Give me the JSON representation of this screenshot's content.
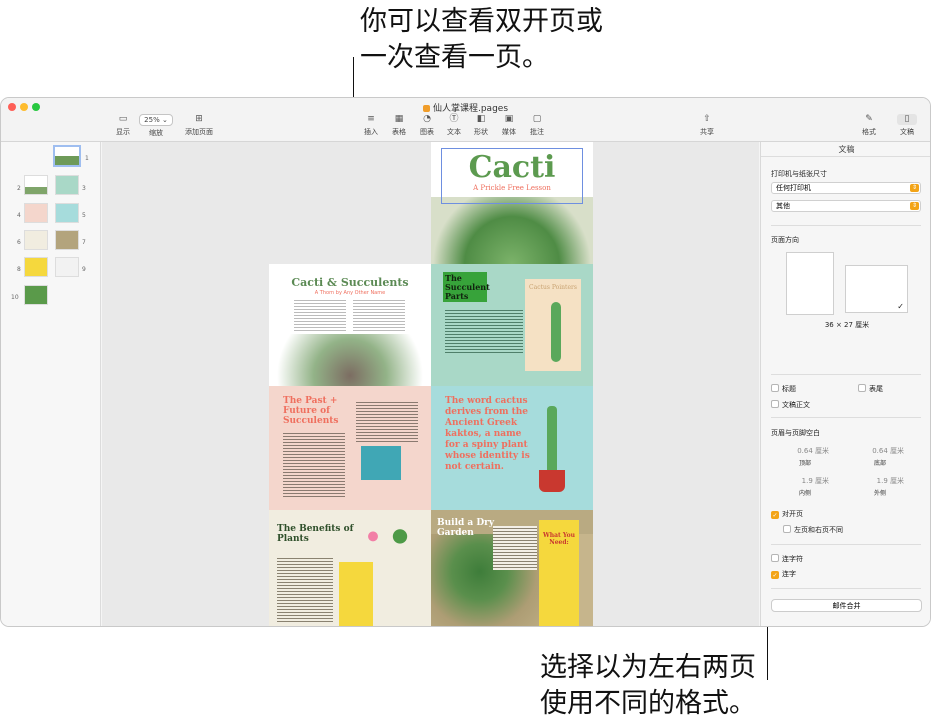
{
  "callouts": {
    "top_line1": "你可以查看双开页或",
    "top_line2": "一次查看一页。",
    "bottom_line1": "选择以为左右两页",
    "bottom_line2": "使用不同的格式。"
  },
  "window": {
    "title": "仙人掌课程.pages",
    "traffic_colors": [
      "#fe5f57",
      "#febc2e",
      "#28c840"
    ]
  },
  "toolbar": {
    "view_label": "显示",
    "zoom_value": "25%",
    "zoom_label": "缩放",
    "add_page_label": "添加页面",
    "insert_label": "插入",
    "table_label": "表格",
    "chart_label": "图表",
    "text_label": "文本",
    "shape_label": "形状",
    "media_label": "媒体",
    "comment_label": "批注",
    "share_label": "共享",
    "format_label": "格式",
    "document_label": "文稿"
  },
  "sidebar": {
    "page_numbers": [
      "1",
      "2",
      "3",
      "4",
      "5",
      "6",
      "7",
      "8",
      "9",
      "10"
    ]
  },
  "pages": {
    "cover_title": "Cacti",
    "cover_subtitle": "A Prickle Free Lesson",
    "p2_title": "Cacti & Succulents",
    "p2_sub": "A Thorn by Any Other Name",
    "p3_title": "The Succulent Parts",
    "p3_side": "Cactus Pointers",
    "p4_title": "The Past + Future of Succulents",
    "p5_text": "The word cactus derives from the Ancient Greek kaktos, a name for a spiny plant whose identity is not certain.",
    "p6_title": "The Benefits of Plants",
    "p7_title": "Build a Dry Garden",
    "p7_card": "What You Need:"
  },
  "inspector": {
    "tab_title": "文稿",
    "printer_section": "打印机与纸张尺寸",
    "printer_value": "任何打印机",
    "paper_value": "其他",
    "orientation_section": "页面方向",
    "size_text": "36 × 27 厘米",
    "header_label": "标题",
    "footer_label": "表尾",
    "body_label": "文稿正文",
    "margins_section": "页眉与页脚空白",
    "top_value": "0.64 厘米",
    "top_label": "顶部",
    "bottom_value": "0.64 厘米",
    "bottom_label": "底部",
    "inside_value": "1.9 厘米",
    "inside_label": "内侧",
    "outside_value": "1.9 厘米",
    "outside_label": "外侧",
    "facing_pages_label": "对开页",
    "different_lr_label": "左页和右页不同",
    "ligatures_label": "连字符",
    "hyphen_label": "连字",
    "mail_merge_label": "邮件合并",
    "checks": {
      "header": false,
      "footer": false,
      "body": false,
      "facing_pages": true,
      "different_lr": false,
      "ligatures": false,
      "hyphen": true
    }
  },
  "colors": {
    "accent": "#f3a417",
    "cactus_green": "#3f8f3a",
    "coral": "#ef6f5e"
  }
}
